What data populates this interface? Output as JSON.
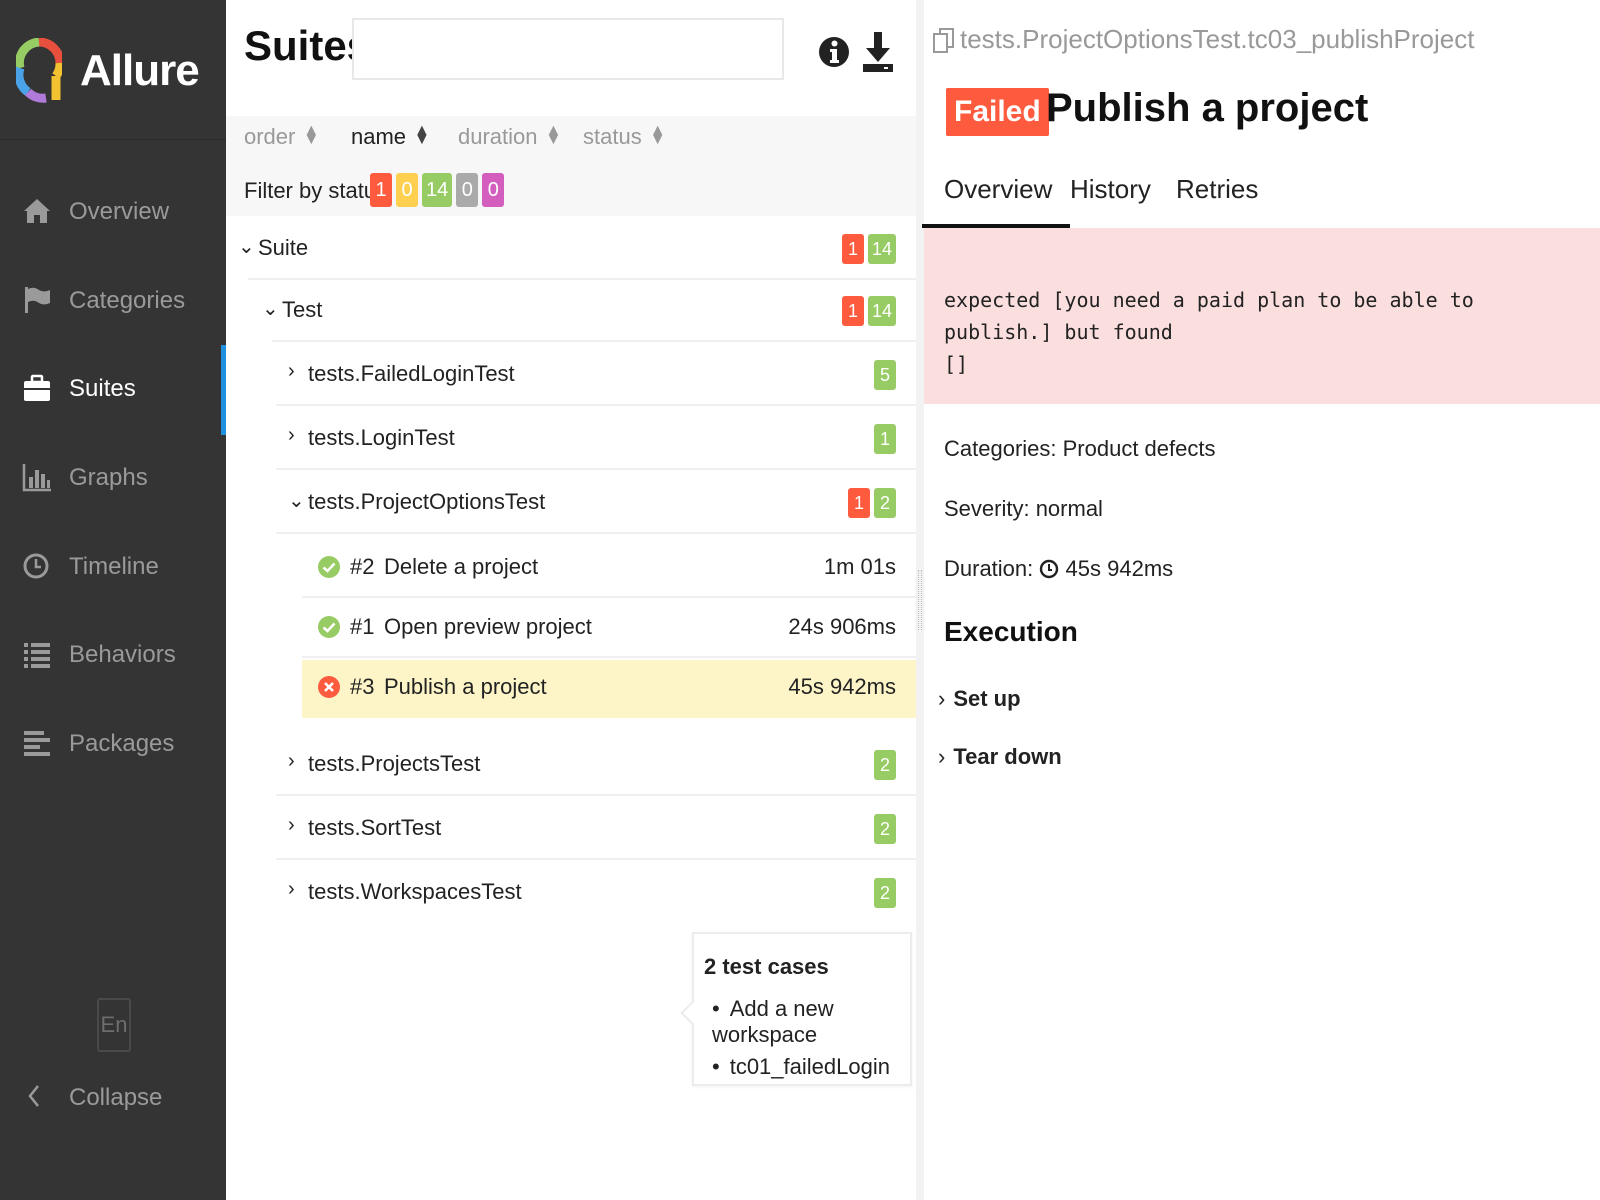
{
  "app": {
    "name": "Allure"
  },
  "sidebar": {
    "items": [
      {
        "label": "Overview",
        "icon": "home-icon"
      },
      {
        "label": "Categories",
        "icon": "flag-icon"
      },
      {
        "label": "Suites",
        "icon": "briefcase-icon",
        "active": true
      },
      {
        "label": "Graphs",
        "icon": "bar-chart-icon"
      },
      {
        "label": "Timeline",
        "icon": "clock-icon"
      },
      {
        "label": "Behaviors",
        "icon": "list-icon"
      },
      {
        "label": "Packages",
        "icon": "align-left-icon"
      }
    ],
    "language": "En",
    "collapse_label": "Collapse"
  },
  "suites_pane": {
    "title": "Suites",
    "search": {
      "value": "",
      "placeholder": ""
    },
    "sort": {
      "order": "order",
      "name": "name",
      "duration": "duration",
      "status": "status",
      "active": "name"
    },
    "filter": {
      "label": "Filter by status:",
      "failed": "1",
      "broken": "0",
      "passed": "14",
      "skipped": "0",
      "unknown": "0"
    },
    "tree": {
      "suite": {
        "label": "Suite",
        "failed": "1",
        "passed": "14"
      },
      "test": {
        "label": "Test",
        "failed": "1",
        "passed": "14"
      },
      "groups": [
        {
          "label": "tests.FailedLoginTest",
          "passed": "5"
        },
        {
          "label": "tests.LoginTest",
          "passed": "1"
        },
        {
          "label": "tests.ProjectOptionsTest",
          "failed": "1",
          "passed": "2"
        },
        {
          "label": "tests.ProjectsTest",
          "passed": "2"
        },
        {
          "label": "tests.SortTest",
          "passed": "2"
        },
        {
          "label": "tests.WorkspacesTest",
          "passed": "2"
        }
      ],
      "cases": [
        {
          "num": "#2",
          "name": "Delete a project",
          "duration": "1m 01s",
          "status": "passed"
        },
        {
          "num": "#1",
          "name": "Open preview project",
          "duration": "24s 906ms",
          "status": "passed"
        },
        {
          "num": "#3",
          "name": "Publish a project",
          "duration": "45s 942ms",
          "status": "failed"
        }
      ]
    },
    "tooltip": {
      "title": "2 test cases",
      "items": [
        "Add a new workspace",
        "tc01_failedLogin"
      ]
    }
  },
  "detail": {
    "path": "tests.ProjectOptionsTest.tc03_publishProject",
    "status": "Failed",
    "title": "Publish a project",
    "tabs": [
      "Overview",
      "History",
      "Retries"
    ],
    "error": "expected [you need a paid plan to be able to publish.] but found\n[]",
    "categories": "Categories: Product defects",
    "severity": "Severity: normal",
    "duration_label": "Duration:",
    "duration_value": "45s 942ms",
    "execution_title": "Execution",
    "setup": "Set up",
    "teardown": "Tear down"
  },
  "colors": {
    "failed": "#fd5a3e",
    "broken": "#ffd050",
    "passed": "#97cc64",
    "skipped": "#aaaaaa",
    "unknown": "#d35ebe",
    "sidebar_bg": "#343434",
    "accent": "#1f8fe0",
    "selected_row": "#fdf5c8",
    "error_bg": "#fbdfdf"
  }
}
